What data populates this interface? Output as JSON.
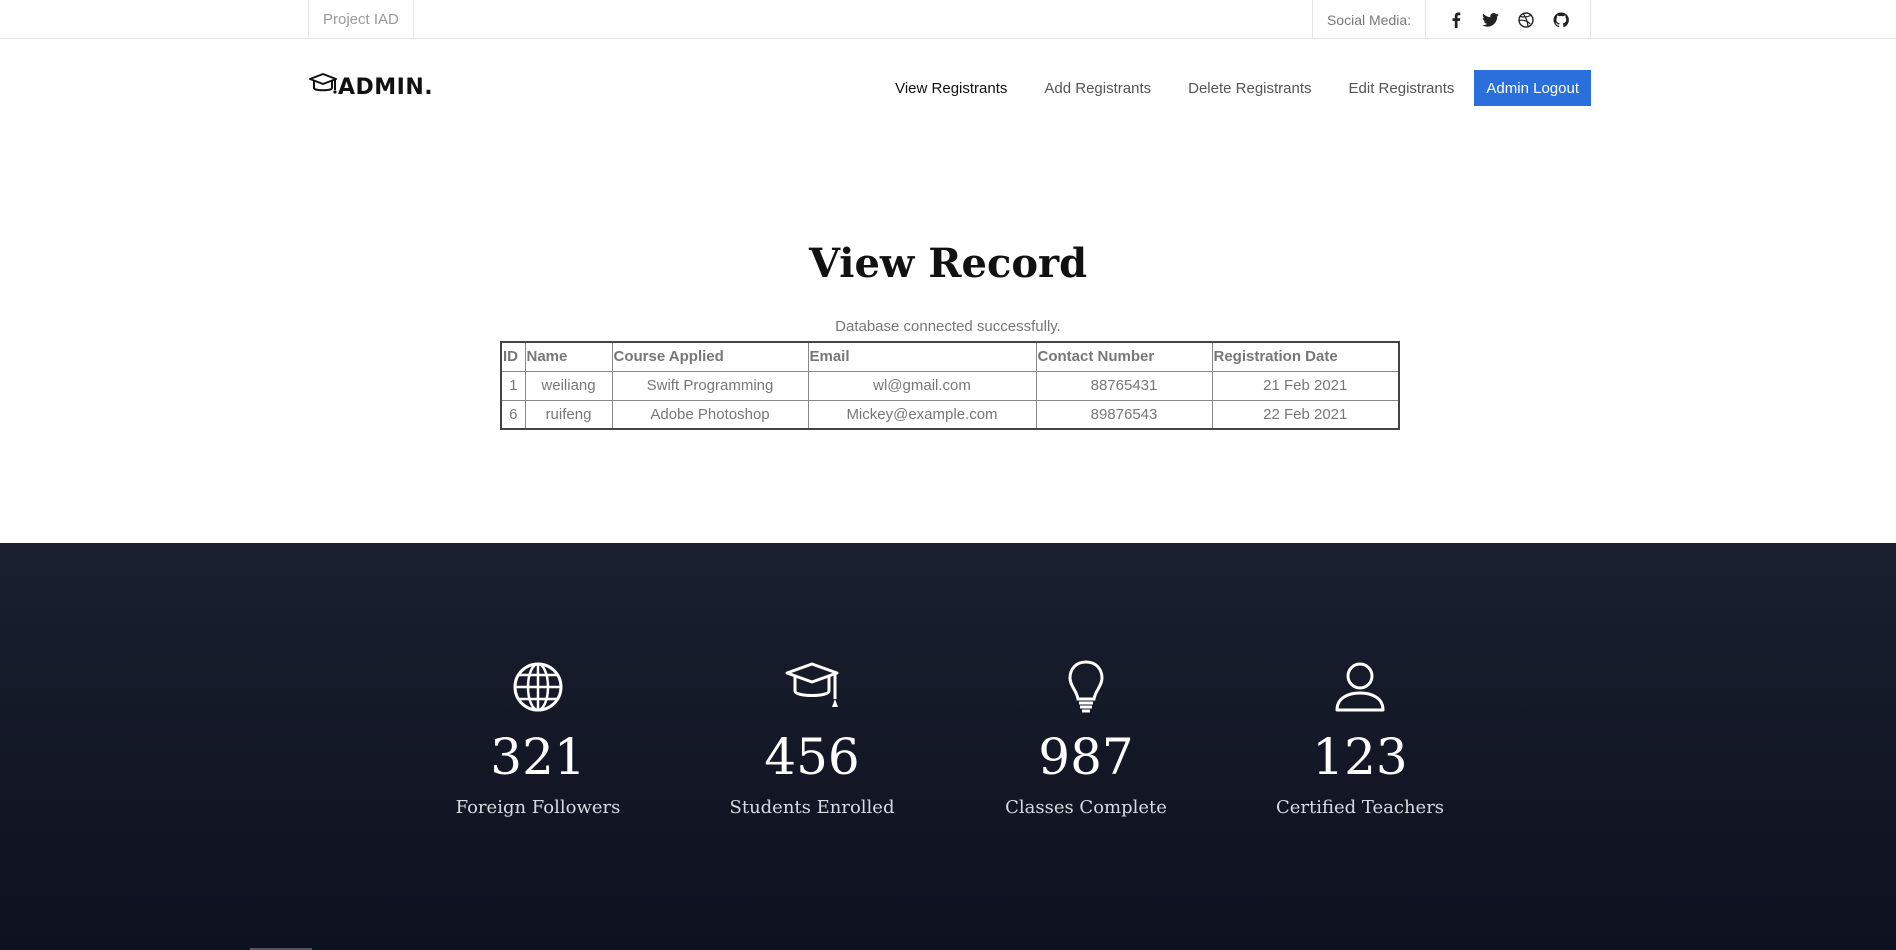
{
  "topbar": {
    "brand": "Project IAD",
    "social_label": "Social Media:",
    "social_icons": [
      "facebook-icon",
      "twitter-icon",
      "dribbble-icon",
      "github-icon"
    ]
  },
  "nav": {
    "logo_text": "ADMIN.",
    "items": [
      {
        "label": "View Registrants"
      },
      {
        "label": "Add Registrants"
      },
      {
        "label": "Delete Registrants"
      },
      {
        "label": "Edit Registrants"
      }
    ],
    "logout_label": "Admin Logout"
  },
  "main": {
    "title": "View Record",
    "status": "Database connected successfully.",
    "table": {
      "headers": [
        "ID",
        "Name",
        "Course Applied",
        "Email",
        "Contact Number",
        "Registration Date"
      ],
      "rows": [
        [
          "1",
          "weiliang",
          "Swift Programming",
          "wl@gmail.com",
          "88765431",
          "21 Feb 2021"
        ],
        [
          "6",
          "ruifeng",
          "Adobe Photoshop",
          "Mickey@example.com",
          "89876543",
          "22 Feb 2021"
        ]
      ]
    }
  },
  "stats": [
    {
      "value": "321",
      "label": "Foreign Followers",
      "icon": "globe-icon"
    },
    {
      "value": "456",
      "label": "Students Enrolled",
      "icon": "graduation-cap-icon"
    },
    {
      "value": "987",
      "label": "Classes Complete",
      "icon": "lightbulb-icon"
    },
    {
      "value": "123",
      "label": "Certified Teachers",
      "icon": "user-icon"
    }
  ],
  "colors": {
    "accent": "#2a6fdb",
    "footer_bg": "#121625"
  }
}
